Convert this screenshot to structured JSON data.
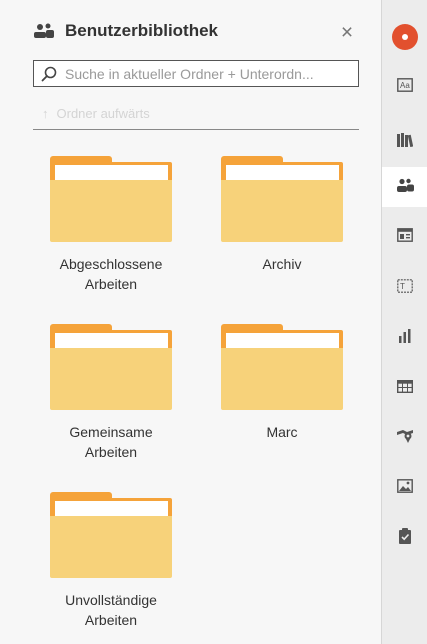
{
  "panel": {
    "title": "Benutzerbibliothek",
    "close_symbol": "×",
    "search_placeholder": "Suche in aktueller Ordner + Unterordn...",
    "up_label": "Ordner aufwärts",
    "up_icon": "arrow-up-icon"
  },
  "folders": [
    {
      "line1": "Abgeschlossene",
      "line2": "Arbeiten"
    },
    {
      "line1": "Archiv",
      "line2": ""
    },
    {
      "line1": "Gemeinsame",
      "line2": "Arbeiten"
    },
    {
      "line1": "Marc",
      "line2": ""
    },
    {
      "line1": "Unvollständige",
      "line2": "Arbeiten"
    }
  ],
  "sidebar": {
    "icons": [
      "app-logo-icon",
      "text-style-icon",
      "books-icon",
      "user-library-icon",
      "layout-icon",
      "text-frame-icon",
      "bar-chart-icon",
      "table-icon",
      "location-icon",
      "image-icon",
      "clipboard-icon"
    ],
    "active": "user-library-icon"
  },
  "colors": {
    "accent": "#e2502e",
    "folder_back": "#f5a33a",
    "folder_front": "#f7d27a"
  }
}
